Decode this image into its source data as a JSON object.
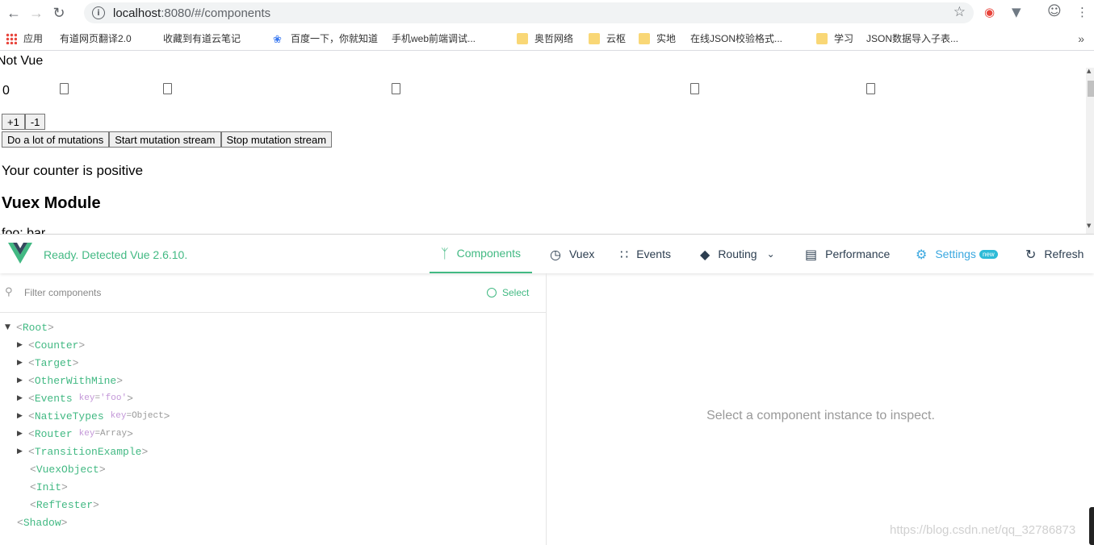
{
  "browser": {
    "url_host": "localhost",
    "url_rest": ":8080/#/components",
    "bookmarks": [
      {
        "label": "应用",
        "icon": "apps"
      },
      {
        "label": "有道网页翻译2.0",
        "icon": "page"
      },
      {
        "label": "收藏到有道云笔记",
        "icon": "page"
      },
      {
        "label": "百度一下，你就知道",
        "icon": "paw"
      },
      {
        "label": "手机web前端调试...",
        "icon": "page"
      },
      {
        "label": "奥哲网络",
        "icon": "folder"
      },
      {
        "label": "云枢",
        "icon": "folder"
      },
      {
        "label": "实地",
        "icon": "folder"
      },
      {
        "label": "在线JSON校验格式...",
        "icon": "page"
      },
      {
        "label": "学习",
        "icon": "folder"
      },
      {
        "label": "JSON数据导入子表...",
        "icon": "page"
      }
    ],
    "more": "»"
  },
  "page": {
    "not_vue": "Not Vue",
    "counter_value": "0",
    "buttons_row1": [
      "+1",
      "-1"
    ],
    "buttons_row2": [
      "Do a lot of mutations",
      "Start mutation stream",
      "Stop mutation stream"
    ],
    "message": "Your counter is positive",
    "heading": "Vuex Module",
    "cut_text": "foo: bar"
  },
  "devtools": {
    "status": "Ready. Detected Vue 2.6.10.",
    "tabs": {
      "components": "Components",
      "vuex": "Vuex",
      "events": "Events",
      "routing": "Routing",
      "performance": "Performance",
      "settings": "Settings",
      "settings_badge": "new",
      "refresh": "Refresh"
    },
    "filter_placeholder": "Filter components",
    "select_label": "Select",
    "tree": [
      {
        "name": "Root",
        "expanded": true,
        "depth": 0
      },
      {
        "name": "Counter",
        "collapsed": true,
        "depth": 1
      },
      {
        "name": "Target",
        "collapsed": true,
        "depth": 1
      },
      {
        "name": "OtherWithMine",
        "collapsed": true,
        "depth": 1
      },
      {
        "name": "Events",
        "collapsed": true,
        "depth": 1,
        "key": "key",
        "keyval": "'foo'"
      },
      {
        "name": "NativeTypes",
        "collapsed": true,
        "depth": 1,
        "key": "key",
        "keyval": "Object"
      },
      {
        "name": "Router",
        "collapsed": true,
        "depth": 1,
        "key": "key",
        "keyval": "Array"
      },
      {
        "name": "TransitionExample",
        "collapsed": true,
        "depth": 1
      },
      {
        "name": "VuexObject",
        "depth": 1
      },
      {
        "name": "Init",
        "depth": 1
      },
      {
        "name": "RefTester",
        "depth": 1
      },
      {
        "name": "Shadow",
        "depth": 0
      }
    ],
    "inspect_hint": "Select a component instance to inspect."
  },
  "watermark": "https://blog.csdn.net/qq_32786873",
  "colors": {
    "vue_green": "#42b983",
    "settings_blue": "#3ba8e0"
  }
}
